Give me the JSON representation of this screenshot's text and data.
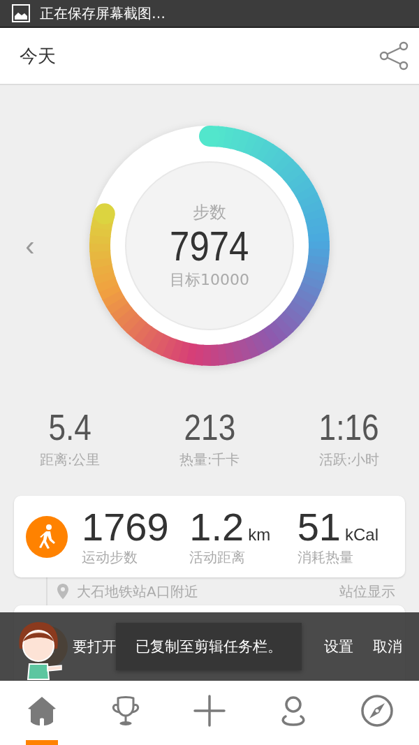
{
  "status_bar": {
    "notification": "正在保存屏幕截图…"
  },
  "header": {
    "title": "今天"
  },
  "ring": {
    "label": "步数",
    "value": "7974",
    "goal": "目标10000"
  },
  "prev_arrow": "‹",
  "stats": [
    {
      "value": "5.4",
      "label": "距离:公里"
    },
    {
      "value": "213",
      "label": "热量:千卡"
    },
    {
      "value": "1:16",
      "label": "活跃:小时"
    }
  ],
  "timeline": [
    {
      "kind": "activity",
      "steps": "1769",
      "steps_label": "运动步数",
      "distance": "1.2",
      "distance_unit": "km",
      "distance_label": "活动距离",
      "calories": "51",
      "calories_unit": "kCal",
      "calories_label": "消耗热量"
    },
    {
      "kind": "location",
      "place": "大石地铁站A口附近",
      "action": "站位显示"
    },
    {
      "kind": "activity"
    }
  ],
  "snackbar": {
    "message": "要打开",
    "actions": [
      "设置",
      "取消"
    ]
  },
  "toast": {
    "message": "已复制至剪辑任务栏。"
  },
  "tabbar": [
    {
      "kind": "home",
      "selected": true
    },
    {
      "kind": "trophy",
      "selected": false
    },
    {
      "kind": "add",
      "selected": false
    },
    {
      "kind": "profile",
      "selected": false
    },
    {
      "kind": "compass",
      "selected": false
    }
  ]
}
